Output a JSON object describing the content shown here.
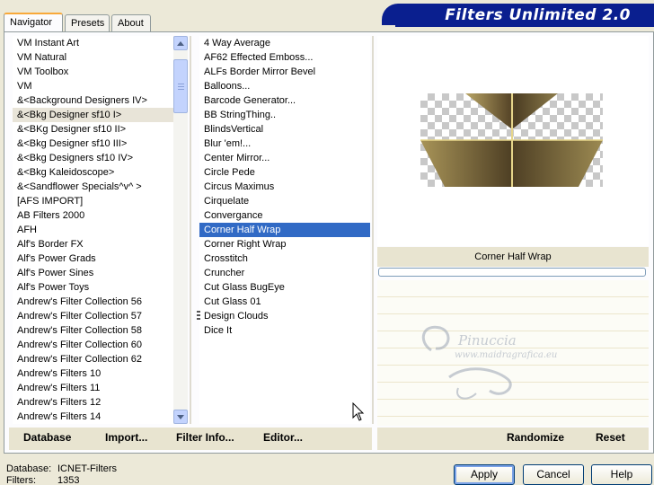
{
  "tabs": [
    {
      "label": "Navigator",
      "active": true
    },
    {
      "label": "Presets",
      "active": false
    },
    {
      "label": "About",
      "active": false
    }
  ],
  "banner": {
    "title": "Filters Unlimited 2.0",
    "color": "#0a1f8f"
  },
  "categories": [
    "VM Instant Art",
    "VM Natural",
    "VM Toolbox",
    "VM",
    "&<Background Designers IV>",
    "&<Bkg Designer sf10 I>",
    "&<BKg Designer sf10 II>",
    "&<Bkg Designer sf10 III>",
    "&<Bkg Designers sf10 IV>",
    "&<Bkg Kaleidoscope>",
    "&<Sandflower Specials^v^ >",
    "[AFS IMPORT]",
    "AB Filters 2000",
    "AFH",
    "Alf's Border FX",
    "Alf's Power Grads",
    "Alf's Power Sines",
    "Alf's Power Toys",
    "Andrew's Filter Collection 56",
    "Andrew's Filter Collection 57",
    "Andrew's Filter Collection 58",
    "Andrew's Filter Collection 60",
    "Andrew's Filter Collection 62",
    "Andrew's Filters 10",
    "Andrew's Filters 11",
    "Andrew's Filters 12",
    "Andrew's Filters 14"
  ],
  "selected_category": "&<Bkg Designer sf10 I>",
  "filters": [
    "4 Way Average",
    "AF62 Effected Emboss...",
    "ALFs Border Mirror Bevel",
    "Balloons...",
    "Barcode Generator...",
    "BB StringThing..",
    "BlindsVertical",
    "Blur 'em!...",
    "Center Mirror...",
    "Circle Pede",
    "Circus Maximus",
    "Cirquelate",
    "Convergance",
    "Corner Half Wrap",
    "Corner Right Wrap",
    "Crosstitch",
    "Cruncher",
    "Cut Glass  BugEye",
    "Cut Glass 01",
    "Design Clouds",
    "Dice It"
  ],
  "selected_filter": "Corner Half Wrap",
  "preview": {
    "filter_name": "Corner Half Wrap"
  },
  "watermark": {
    "name": "Pinuccia",
    "url": "www.maidragrafica.eu"
  },
  "bottom_left": [
    {
      "label": "Database",
      "underline": "D"
    },
    {
      "label": "Import...",
      "underline": "I"
    },
    {
      "label": "Filter Info...",
      "underline": "F"
    },
    {
      "label": "Editor...",
      "underline": "E"
    }
  ],
  "bottom_right": [
    {
      "label": "Randomize"
    },
    {
      "label": "Reset"
    }
  ],
  "status": {
    "database_label": "Database:",
    "database_value": "ICNET-Filters",
    "filters_label": "Filters:",
    "filters_value": "1353"
  },
  "buttons": {
    "apply": "Apply",
    "cancel": "Cancel",
    "help": "Help"
  },
  "colors": {
    "selection": "#316ac5",
    "window_bg": "#ece9d8",
    "bronze_dark": "#5a4a2e",
    "bronze_light": "#c9b46a"
  }
}
